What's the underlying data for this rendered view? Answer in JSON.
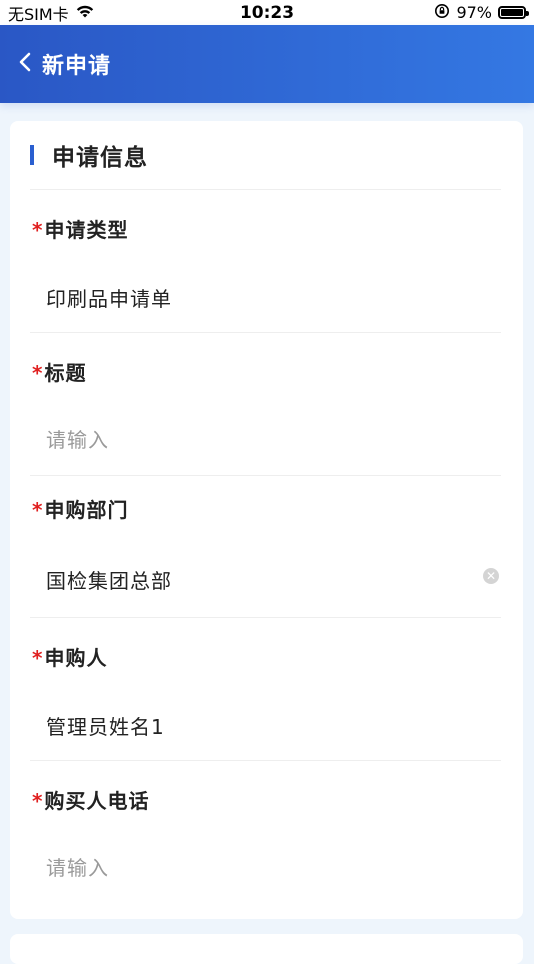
{
  "status_bar": {
    "carrier": "无SIM卡",
    "time": "10:23",
    "battery": "97%"
  },
  "nav": {
    "title": "新申请"
  },
  "section": {
    "title": "申请信息"
  },
  "fields": [
    {
      "label": "申请类型",
      "value": "印刷品申请单",
      "placeholder": ""
    },
    {
      "label": "标题",
      "value": "",
      "placeholder": "请输入"
    },
    {
      "label": "申购部门",
      "value": "国检集团总部",
      "placeholder": ""
    },
    {
      "label": "申购人",
      "value": "管理员姓名1",
      "placeholder": ""
    },
    {
      "label": "购买人电话",
      "value": "",
      "placeholder": "请输入"
    }
  ],
  "required_mark": "*",
  "colors": {
    "nav_gradient_start": "#2a57c5",
    "nav_gradient_end": "#3478e3",
    "required": "#e02020",
    "section_bar": "#2a5fd0",
    "background": "#eef5fc"
  }
}
